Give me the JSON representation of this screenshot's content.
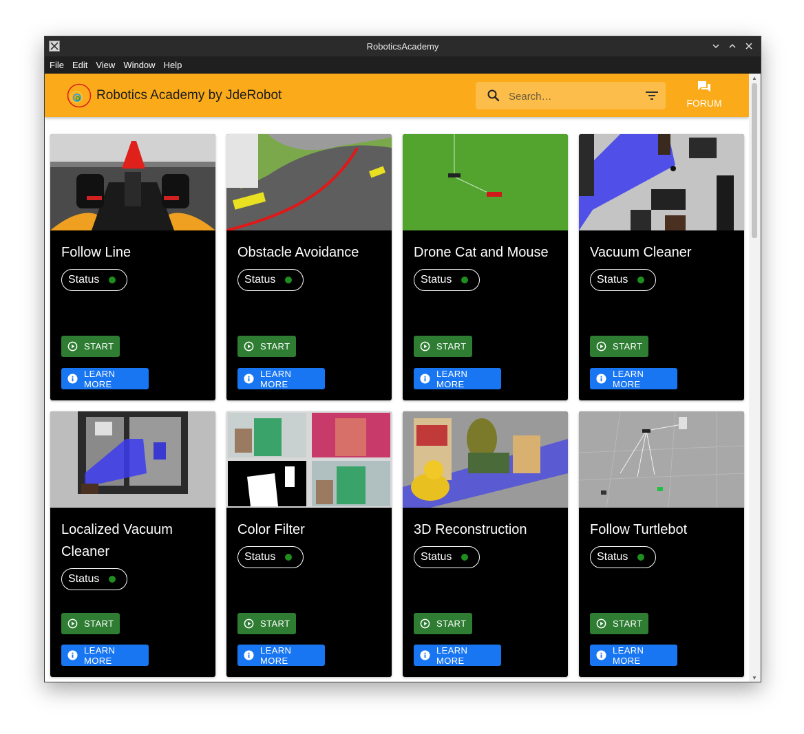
{
  "window": {
    "title": "RoboticsAcademy"
  },
  "menu": [
    "File",
    "Edit",
    "View",
    "Window",
    "Help"
  ],
  "appbar": {
    "brand": "Robotics Academy by JdeRobot",
    "search_placeholder": "Search…",
    "forum_label": "FORUM",
    "color": "#fbab19"
  },
  "cards": [
    {
      "title": "Follow Line",
      "status": "Status",
      "start": "START",
      "learn": "LEARN MORE"
    },
    {
      "title": "Obstacle Avoidance",
      "status": "Status",
      "start": "START",
      "learn": "LEARN MORE"
    },
    {
      "title": "Drone Cat and Mouse",
      "status": "Status",
      "start": "START",
      "learn": "LEARN MORE"
    },
    {
      "title": "Vacuum Cleaner",
      "status": "Status",
      "start": "START",
      "learn": "LEARN MORE"
    },
    {
      "title": "Localized Vacuum Cleaner",
      "status": "Status",
      "start": "START",
      "learn": "LEARN MORE"
    },
    {
      "title": "Color Filter",
      "status": "Status",
      "start": "START",
      "learn": "LEARN MORE"
    },
    {
      "title": "3D Reconstruction",
      "status": "Status",
      "start": "START",
      "learn": "LEARN MORE"
    },
    {
      "title": "Follow Turtlebot",
      "status": "Status",
      "start": "START",
      "learn": "LEARN MORE"
    }
  ],
  "colors": {
    "status_dot": "#1e8e1e",
    "start_button": "#2e7d32",
    "learn_button": "#1976f2",
    "card_bg": "#000000"
  },
  "icons": {
    "search": "search-icon",
    "filter": "filter-icon",
    "forum": "forum-icon",
    "start": "play-circle-icon",
    "learn": "info-icon"
  }
}
